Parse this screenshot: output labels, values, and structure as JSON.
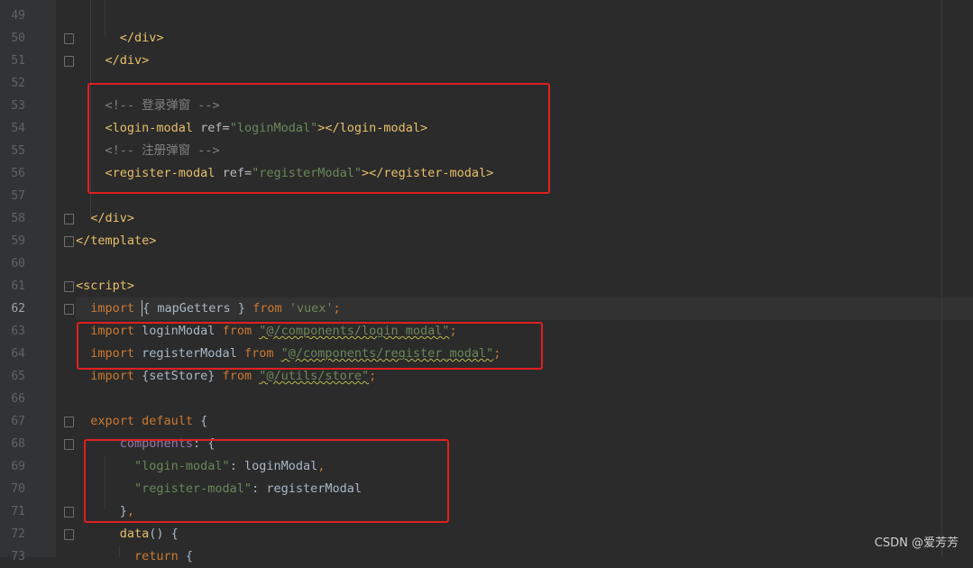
{
  "lines": [
    {
      "n": "49",
      "segs": []
    },
    {
      "n": "50",
      "segs": [
        {
          "c": "tag",
          "t": "      </div>"
        }
      ]
    },
    {
      "n": "51",
      "segs": [
        {
          "c": "tag",
          "t": "    </div>"
        }
      ]
    },
    {
      "n": "52",
      "segs": []
    },
    {
      "n": "53",
      "segs": [
        {
          "c": "comment",
          "t": "    <!-- 登录弹窗 -->"
        }
      ]
    },
    {
      "n": "54",
      "segs": [
        {
          "c": "tag",
          "t": "    <login-modal "
        },
        {
          "c": "attr",
          "t": "ref="
        },
        {
          "c": "str",
          "t": "\"loginModal\""
        },
        {
          "c": "tag",
          "t": "></login-modal>"
        }
      ]
    },
    {
      "n": "55",
      "segs": [
        {
          "c": "comment",
          "t": "    <!-- 注册弹窗 -->"
        }
      ]
    },
    {
      "n": "56",
      "segs": [
        {
          "c": "tag",
          "t": "    <register-modal "
        },
        {
          "c": "attr",
          "t": "ref="
        },
        {
          "c": "str",
          "t": "\"registerModal\""
        },
        {
          "c": "tag",
          "t": "></register-modal>"
        }
      ]
    },
    {
      "n": "57",
      "segs": []
    },
    {
      "n": "58",
      "segs": [
        {
          "c": "tag",
          "t": "  </div>"
        }
      ]
    },
    {
      "n": "59",
      "segs": [
        {
          "c": "tag",
          "t": "</template>"
        }
      ]
    },
    {
      "n": "60",
      "segs": []
    },
    {
      "n": "61",
      "segs": [
        {
          "c": "tag",
          "t": "<script>"
        }
      ]
    },
    {
      "n": "62",
      "segs": [
        {
          "c": "kw",
          "t": "  import "
        },
        {
          "c": "caret",
          "t": ""
        },
        {
          "c": "plain",
          "t": "{ mapGetters } "
        },
        {
          "c": "kw",
          "t": "from "
        },
        {
          "c": "str",
          "t": "'vuex'"
        },
        {
          "c": "kw",
          "t": ";"
        }
      ]
    },
    {
      "n": "63",
      "segs": [
        {
          "c": "kw",
          "t": "  import "
        },
        {
          "c": "plain",
          "t": "loginModal "
        },
        {
          "c": "kw",
          "t": "from "
        },
        {
          "c": "str squig",
          "t": "\"@/components/login_modal\""
        },
        {
          "c": "kw",
          "t": ";"
        }
      ]
    },
    {
      "n": "64",
      "segs": [
        {
          "c": "kw",
          "t": "  import "
        },
        {
          "c": "plain",
          "t": "registerModal "
        },
        {
          "c": "kw",
          "t": "from "
        },
        {
          "c": "str squig",
          "t": "\"@/components/register_modal\""
        },
        {
          "c": "kw",
          "t": ";"
        }
      ]
    },
    {
      "n": "65",
      "segs": [
        {
          "c": "kw",
          "t": "  import "
        },
        {
          "c": "plain",
          "t": "{setStore} "
        },
        {
          "c": "kw",
          "t": "from "
        },
        {
          "c": "str squig",
          "t": "\"@/utils/store\""
        },
        {
          "c": "kw",
          "t": ";"
        }
      ]
    },
    {
      "n": "66",
      "segs": []
    },
    {
      "n": "67",
      "segs": [
        {
          "c": "kw",
          "t": "  export default "
        },
        {
          "c": "plain",
          "t": "{"
        }
      ]
    },
    {
      "n": "68",
      "segs": [
        {
          "c": "purple",
          "t": "      components"
        },
        {
          "c": "plain",
          "t": ": {"
        }
      ]
    },
    {
      "n": "69",
      "segs": [
        {
          "c": "str",
          "t": "        \"login-modal\""
        },
        {
          "c": "plain",
          "t": ": loginModal"
        },
        {
          "c": "kw",
          "t": ","
        }
      ]
    },
    {
      "n": "70",
      "segs": [
        {
          "c": "str",
          "t": "        \"register-modal\""
        },
        {
          "c": "plain",
          "t": ": registerModal"
        }
      ]
    },
    {
      "n": "71",
      "segs": [
        {
          "c": "plain",
          "t": "      }"
        },
        {
          "c": "kw",
          "t": ","
        }
      ]
    },
    {
      "n": "72",
      "segs": [
        {
          "c": "plain",
          "t": "      "
        },
        {
          "c": "tag",
          "t": "data"
        },
        {
          "c": "plain",
          "t": "() {"
        }
      ]
    },
    {
      "n": "73",
      "segs": [
        {
          "c": "kw",
          "t": "        return "
        },
        {
          "c": "plain",
          "t": "{"
        }
      ]
    }
  ],
  "current_line": "62",
  "fold_lines": [
    "50",
    "51",
    "58",
    "59",
    "61",
    "62",
    "67",
    "68",
    "71",
    "72"
  ],
  "watermark": "CSDN @爱芳芳"
}
